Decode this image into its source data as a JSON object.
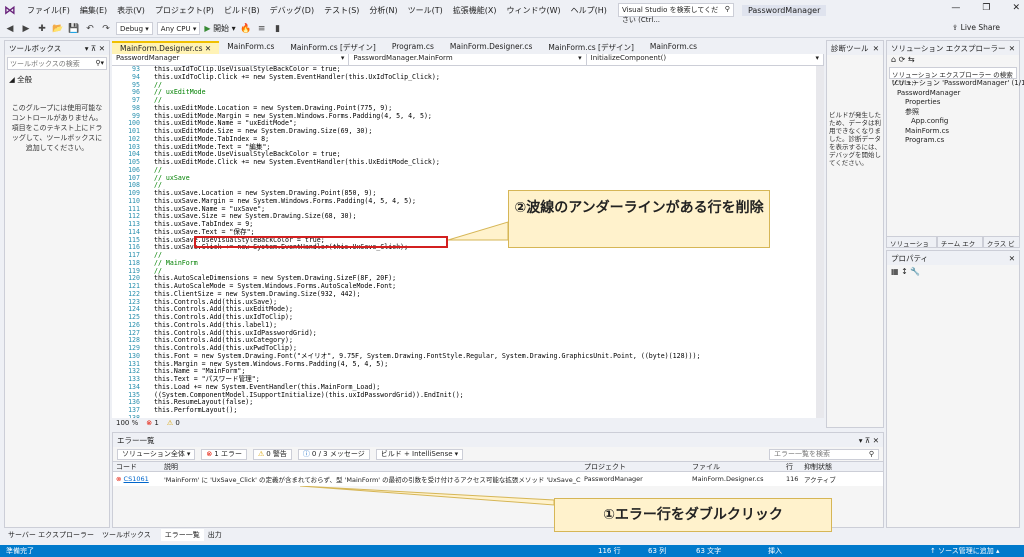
{
  "menu": [
    "ファイル(F)",
    "編集(E)",
    "表示(V)",
    "プロジェクト(P)",
    "ビルド(B)",
    "デバッグ(D)",
    "テスト(S)",
    "分析(N)",
    "ツール(T)",
    "拡張機能(X)",
    "ウィンドウ(W)",
    "ヘルプ(H)"
  ],
  "search_placeholder": "Visual Studio を検索してください (Ctrl...",
  "project_title": "PasswordManager",
  "toolbar": {
    "config": "Debug",
    "platform": "Any CPU",
    "start": "開始",
    "live_share": "Live Share"
  },
  "toolbox": {
    "title": "ツールボックス",
    "search": "ツールボックスの検索",
    "group": "◢ 全般",
    "message": "このグループには使用可能なコントロールがありません。項目をこのテキスト上にドラッグして、ツールボックスに追加してください。"
  },
  "tabs": [
    "MainForm.Designer.cs",
    "MainForm.cs",
    "MainForm.cs [デザイン]",
    "Program.cs",
    "MainForm.Designer.cs",
    "MainForm.cs [デザイン]",
    "MainForm.cs"
  ],
  "nav": [
    "PasswordManager",
    "PasswordManager.MainForm",
    "InitializeComponent()"
  ],
  "code": {
    "line_numbers": [
      "93",
      "94",
      "95",
      "96",
      "97",
      "98",
      "99",
      "100",
      "101",
      "102",
      "103",
      "104",
      "105",
      "106",
      "107",
      "108",
      "109",
      "110",
      "111",
      "112",
      "113",
      "114",
      "115",
      "116",
      "117",
      "118",
      "119",
      "120",
      "121",
      "122",
      "123",
      "124",
      "125",
      "126",
      "127",
      "128",
      "129",
      "130",
      "131",
      "132",
      "133",
      "134",
      "135",
      "136",
      "137",
      "138",
      "139",
      "140"
    ],
    "lines": [
      "this.uxIdToClip.UseVisualStyleBackColor = true;",
      "this.uxIdToClip.Click += new System.EventHandler(this.UxIdToClip_Click);",
      "//",
      "// uxEditMode",
      "//",
      "this.uxEditMode.Location = new System.Drawing.Point(775, 9);",
      "this.uxEditMode.Margin = new System.Windows.Forms.Padding(4, 5, 4, 5);",
      "this.uxEditMode.Name = \"uxEditMode\";",
      "this.uxEditMode.Size = new System.Drawing.Size(69, 30);",
      "this.uxEditMode.TabIndex = 8;",
      "this.uxEditMode.Text = \"編集\";",
      "this.uxEditMode.UseVisualStyleBackColor = true;",
      "this.uxEditMode.Click += new System.EventHandler(this.UxEditMode_Click);",
      "//",
      "// uxSave",
      "//",
      "this.uxSave.Location = new System.Drawing.Point(850, 9);",
      "this.uxSave.Margin = new System.Windows.Forms.Padding(4, 5, 4, 5);",
      "this.uxSave.Name = \"uxSave\";",
      "this.uxSave.Size = new System.Drawing.Size(68, 30);",
      "this.uxSave.TabIndex = 9;",
      "this.uxSave.Text = \"保存\";",
      "this.uxSave.UseVisualStyleBackColor = true;",
      "this.uxSave.Click += new System.EventHandler(this.UxSave_Click);",
      "//",
      "// MainForm",
      "//",
      "this.AutoScaleDimensions = new System.Drawing.SizeF(8F, 20F);",
      "this.AutoScaleMode = System.Windows.Forms.AutoScaleMode.Font;",
      "this.ClientSize = new System.Drawing.Size(932, 442);",
      "this.Controls.Add(this.uxSave);",
      "this.Controls.Add(this.uxEditMode);",
      "this.Controls.Add(this.uxIdToClip);",
      "this.Controls.Add(this.label1);",
      "this.Controls.Add(this.uxIdPasswordGrid);",
      "this.Controls.Add(this.uxCategory);",
      "this.Controls.Add(this.uxPwdToClip);",
      "this.Font = new System.Drawing.Font(\"メイリオ\", 9.75F, System.Drawing.FontStyle.Regular, System.Drawing.GraphicsUnit.Point, ((byte)(128)));",
      "this.Margin = new System.Windows.Forms.Padding(4, 5, 4, 5);",
      "this.Name = \"MainForm\";",
      "this.Text = \"パスワード管理\";",
      "this.Load += new System.EventHandler(this.MainForm_Load);",
      "((System.ComponentModel.ISupportInitialize)(this.uxIdPasswordGrid)).EndInit();",
      "this.ResumeLayout(false);",
      "this.PerformLayout();",
      "",
      "}",
      ""
    ]
  },
  "editor_status": {
    "zoom": "100 %",
    "errors": "1",
    "warnings": "0"
  },
  "callout_top": "②波線のアンダーラインがある行を削除",
  "callout_bottom": "①エラー行をダブルクリック",
  "diagnostics": {
    "title": "診断ツール",
    "text": "ビルドが発生したため、データは利用できなくなりました。診断データを表示するには、デバッグを開始してください。"
  },
  "solution": {
    "title": "ソリューション エクスプローラー",
    "search": "ソリューション エクスプローラー の検索 (Ctrl+;)",
    "items": [
      "ソリューション 'PasswordManager' (1/1 プロ",
      "PasswordManager",
      "Properties",
      "参照",
      "App.config",
      "MainForm.cs",
      "Program.cs"
    ],
    "tabs": [
      "ソリューション エ...",
      "チーム エクスプ...",
      "クラス ビュー"
    ]
  },
  "properties": {
    "title": "プロパティ"
  },
  "errors": {
    "title": "エラー一覧",
    "scope": "ソリューション全体",
    "error_count": "1 エラー",
    "warning_count": "0 警告",
    "message_count": "0 / 3 メッセージ",
    "build_filter": "ビルド + IntelliSense",
    "search": "エラー一覧を検索",
    "columns": [
      "コード",
      "説明",
      "プロジェクト",
      "ファイル",
      "行",
      "抑制状態"
    ],
    "row": {
      "code": "CS1061",
      "desc": "'MainForm' に 'UxSave_Click' の定義が含まれておらず、型 'MainForm' の最初の引数を受け付けるアクセス可能な拡張メソッド 'UxSave_Click' が見つかりませんでした。using ディレクティブまたはアセンブリ参照が不足していないことを確認してください。",
      "project": "PasswordManager",
      "file": "MainForm.Designer.cs",
      "line": "116",
      "state": "アクティブ"
    }
  },
  "bottom_tabs": [
    "サーバー エクスプローラー",
    "ツールボックス",
    "エラー一覧",
    "出力"
  ],
  "status": {
    "ready": "準備完了",
    "line": "116 行",
    "col": "63 列",
    "char": "63 文字",
    "mode": "挿入",
    "source": "↑ ソース管理に追加 ▴"
  }
}
